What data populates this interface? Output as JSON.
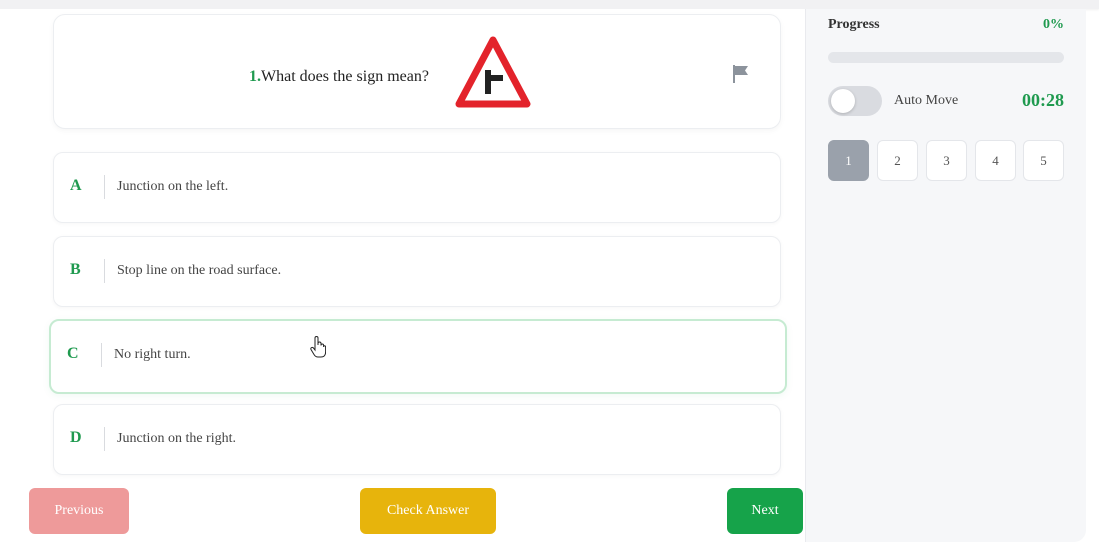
{
  "question": {
    "number": "1.",
    "text": "What does the sign mean?",
    "sign_icon": "side-road-junction-warning-sign",
    "flag_icon": "flag-icon"
  },
  "options": [
    {
      "letter": "A",
      "text": "Junction on the left."
    },
    {
      "letter": "B",
      "text": "Stop line on the road surface."
    },
    {
      "letter": "C",
      "text": "No right turn."
    },
    {
      "letter": "D",
      "text": "Junction on the right."
    }
  ],
  "selected_option": "C",
  "buttons": {
    "previous": "Previous",
    "check": "Check Answer",
    "next": "Next"
  },
  "sidebar": {
    "progress_label": "Progress",
    "progress_value": "0%",
    "progress_fraction": 0,
    "auto_move_label": "Auto Move",
    "auto_move_on": false,
    "timer": "00:28",
    "question_numbers": [
      "1",
      "2",
      "3",
      "4",
      "5"
    ],
    "active_question": "1"
  },
  "colors": {
    "accent": "#1f9a4f",
    "previous_button": "#ee9a9a",
    "check_button": "#e7b40c",
    "next_button": "#16a34a",
    "sign_red": "#e3232b"
  }
}
